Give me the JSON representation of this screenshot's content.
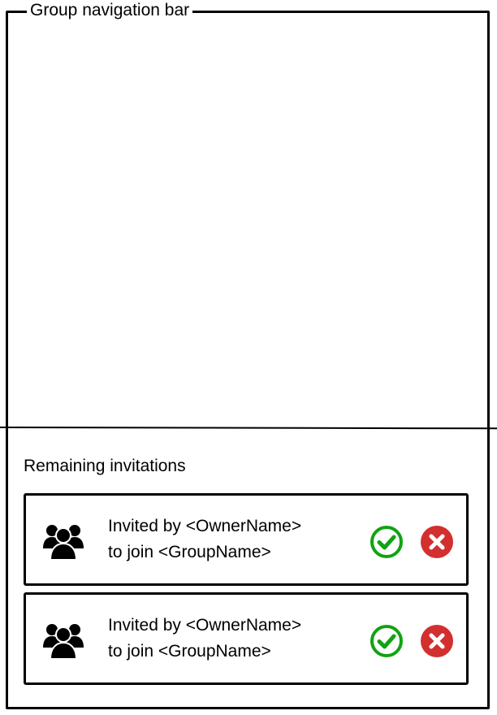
{
  "frame": {
    "title": "Group navigation bar"
  },
  "invitations": {
    "section_title": "Remaining invitations",
    "items": [
      {
        "line1": "Invited by <OwnerName>",
        "line2": "to join <GroupName>",
        "icon": "group-icon",
        "accept_icon": "check-circle-icon",
        "decline_icon": "x-circle-icon"
      },
      {
        "line1": "Invited by <OwnerName>",
        "line2": "to join <GroupName>",
        "icon": "group-icon",
        "accept_icon": "check-circle-icon",
        "decline_icon": "x-circle-icon"
      }
    ]
  },
  "colors": {
    "accept": "#11a311",
    "decline": "#d32f2f",
    "stroke": "#000000"
  }
}
